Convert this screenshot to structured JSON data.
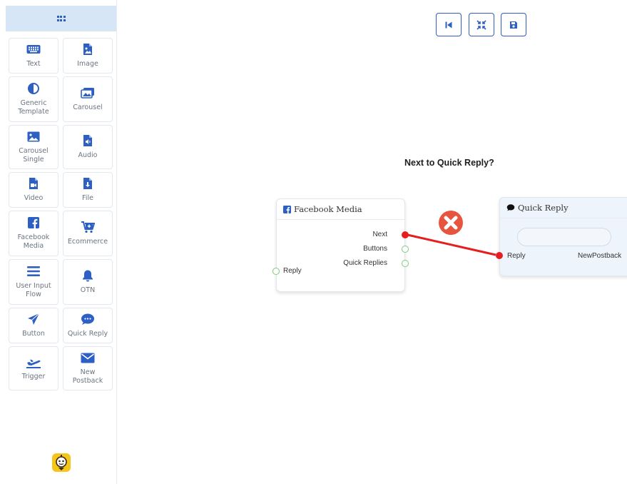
{
  "sidebar": {
    "tiles": [
      {
        "label": "Text",
        "icon": "keyboard-icon"
      },
      {
        "label": "Image",
        "icon": "image-file-icon"
      },
      {
        "label": "Generic Template",
        "icon": "half-circle-icon"
      },
      {
        "label": "Carousel",
        "icon": "images-icon"
      },
      {
        "label": "Carousel Single",
        "icon": "image-icon"
      },
      {
        "label": "Audio",
        "icon": "audio-file-icon"
      },
      {
        "label": "Video",
        "icon": "video-file-icon"
      },
      {
        "label": "File",
        "icon": "download-file-icon"
      },
      {
        "label": "Facebook Media",
        "icon": "facebook-icon"
      },
      {
        "label": "Ecommerce",
        "icon": "cart-icon"
      },
      {
        "label": "User Input Flow",
        "icon": "lines-icon"
      },
      {
        "label": "OTN",
        "icon": "bell-icon"
      },
      {
        "label": "Button",
        "icon": "send-icon"
      },
      {
        "label": "Quick Reply",
        "icon": "chat-icon"
      },
      {
        "label": "Trigger",
        "icon": "plane-icon"
      },
      {
        "label": "New Postback",
        "icon": "envelope-icon"
      }
    ]
  },
  "toolbar": {
    "buttons": [
      "step-backward-icon",
      "compress-icon",
      "save-icon"
    ]
  },
  "canvas": {
    "question": "Next to Quick Reply?",
    "facebook_node": {
      "title": "Facebook Media",
      "outputs": [
        "Next",
        "Buttons",
        "Quick Replies"
      ],
      "input": "Reply"
    },
    "quick_reply_node": {
      "title": "Quick Reply",
      "input": "Reply",
      "output": "NewPostback"
    }
  },
  "colors": {
    "accent": "#2d5fc4",
    "connection": "#e51f1f",
    "delete": "#e8553f",
    "port": "#7cc97c"
  }
}
